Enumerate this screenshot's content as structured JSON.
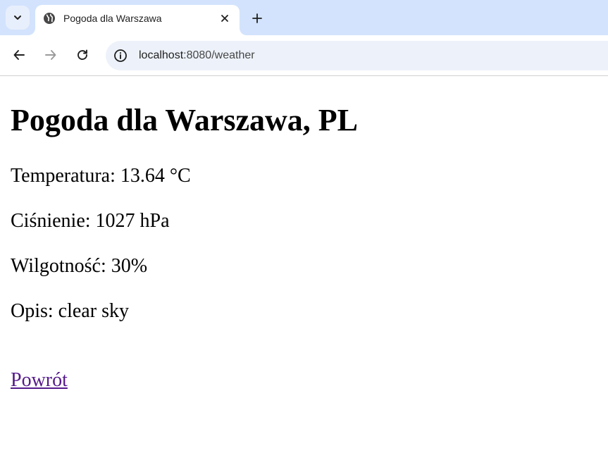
{
  "browser": {
    "tab_title": "Pogoda dla Warszawa",
    "url_host": "localhost",
    "url_path": ":8080/weather"
  },
  "page": {
    "heading": "Pogoda dla Warszawa, PL",
    "temperature": "Temperatura: 13.64 °C",
    "pressure": "Ciśnienie: 1027 hPa",
    "humidity": "Wilgotność: 30%",
    "description": "Opis: clear sky",
    "back_link": "Powrót"
  }
}
